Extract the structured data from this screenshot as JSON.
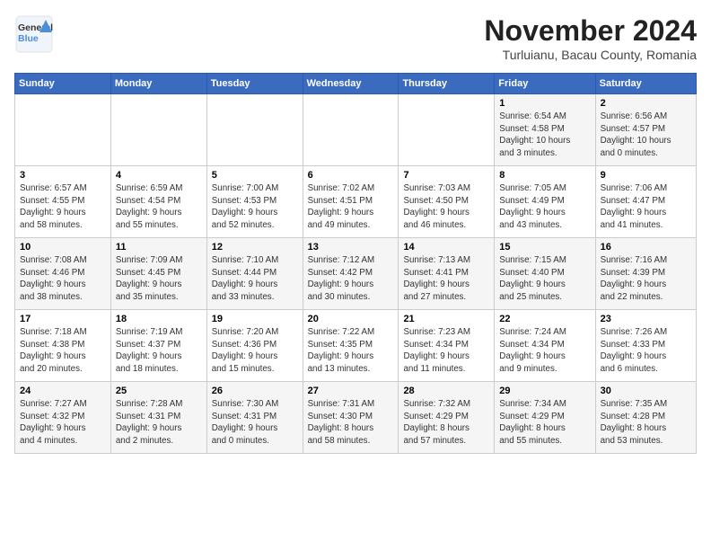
{
  "logo": {
    "line1": "General",
    "line2": "Blue"
  },
  "title": "November 2024",
  "subtitle": "Turluianu, Bacau County, Romania",
  "days_of_week": [
    "Sunday",
    "Monday",
    "Tuesday",
    "Wednesday",
    "Thursday",
    "Friday",
    "Saturday"
  ],
  "weeks": [
    [
      {
        "day": "",
        "info": ""
      },
      {
        "day": "",
        "info": ""
      },
      {
        "day": "",
        "info": ""
      },
      {
        "day": "",
        "info": ""
      },
      {
        "day": "",
        "info": ""
      },
      {
        "day": "1",
        "info": "Sunrise: 6:54 AM\nSunset: 4:58 PM\nDaylight: 10 hours\nand 3 minutes."
      },
      {
        "day": "2",
        "info": "Sunrise: 6:56 AM\nSunset: 4:57 PM\nDaylight: 10 hours\nand 0 minutes."
      }
    ],
    [
      {
        "day": "3",
        "info": "Sunrise: 6:57 AM\nSunset: 4:55 PM\nDaylight: 9 hours\nand 58 minutes."
      },
      {
        "day": "4",
        "info": "Sunrise: 6:59 AM\nSunset: 4:54 PM\nDaylight: 9 hours\nand 55 minutes."
      },
      {
        "day": "5",
        "info": "Sunrise: 7:00 AM\nSunset: 4:53 PM\nDaylight: 9 hours\nand 52 minutes."
      },
      {
        "day": "6",
        "info": "Sunrise: 7:02 AM\nSunset: 4:51 PM\nDaylight: 9 hours\nand 49 minutes."
      },
      {
        "day": "7",
        "info": "Sunrise: 7:03 AM\nSunset: 4:50 PM\nDaylight: 9 hours\nand 46 minutes."
      },
      {
        "day": "8",
        "info": "Sunrise: 7:05 AM\nSunset: 4:49 PM\nDaylight: 9 hours\nand 43 minutes."
      },
      {
        "day": "9",
        "info": "Sunrise: 7:06 AM\nSunset: 4:47 PM\nDaylight: 9 hours\nand 41 minutes."
      }
    ],
    [
      {
        "day": "10",
        "info": "Sunrise: 7:08 AM\nSunset: 4:46 PM\nDaylight: 9 hours\nand 38 minutes."
      },
      {
        "day": "11",
        "info": "Sunrise: 7:09 AM\nSunset: 4:45 PM\nDaylight: 9 hours\nand 35 minutes."
      },
      {
        "day": "12",
        "info": "Sunrise: 7:10 AM\nSunset: 4:44 PM\nDaylight: 9 hours\nand 33 minutes."
      },
      {
        "day": "13",
        "info": "Sunrise: 7:12 AM\nSunset: 4:42 PM\nDaylight: 9 hours\nand 30 minutes."
      },
      {
        "day": "14",
        "info": "Sunrise: 7:13 AM\nSunset: 4:41 PM\nDaylight: 9 hours\nand 27 minutes."
      },
      {
        "day": "15",
        "info": "Sunrise: 7:15 AM\nSunset: 4:40 PM\nDaylight: 9 hours\nand 25 minutes."
      },
      {
        "day": "16",
        "info": "Sunrise: 7:16 AM\nSunset: 4:39 PM\nDaylight: 9 hours\nand 22 minutes."
      }
    ],
    [
      {
        "day": "17",
        "info": "Sunrise: 7:18 AM\nSunset: 4:38 PM\nDaylight: 9 hours\nand 20 minutes."
      },
      {
        "day": "18",
        "info": "Sunrise: 7:19 AM\nSunset: 4:37 PM\nDaylight: 9 hours\nand 18 minutes."
      },
      {
        "day": "19",
        "info": "Sunrise: 7:20 AM\nSunset: 4:36 PM\nDaylight: 9 hours\nand 15 minutes."
      },
      {
        "day": "20",
        "info": "Sunrise: 7:22 AM\nSunset: 4:35 PM\nDaylight: 9 hours\nand 13 minutes."
      },
      {
        "day": "21",
        "info": "Sunrise: 7:23 AM\nSunset: 4:34 PM\nDaylight: 9 hours\nand 11 minutes."
      },
      {
        "day": "22",
        "info": "Sunrise: 7:24 AM\nSunset: 4:34 PM\nDaylight: 9 hours\nand 9 minutes."
      },
      {
        "day": "23",
        "info": "Sunrise: 7:26 AM\nSunset: 4:33 PM\nDaylight: 9 hours\nand 6 minutes."
      }
    ],
    [
      {
        "day": "24",
        "info": "Sunrise: 7:27 AM\nSunset: 4:32 PM\nDaylight: 9 hours\nand 4 minutes."
      },
      {
        "day": "25",
        "info": "Sunrise: 7:28 AM\nSunset: 4:31 PM\nDaylight: 9 hours\nand 2 minutes."
      },
      {
        "day": "26",
        "info": "Sunrise: 7:30 AM\nSunset: 4:31 PM\nDaylight: 9 hours\nand 0 minutes."
      },
      {
        "day": "27",
        "info": "Sunrise: 7:31 AM\nSunset: 4:30 PM\nDaylight: 8 hours\nand 58 minutes."
      },
      {
        "day": "28",
        "info": "Sunrise: 7:32 AM\nSunset: 4:29 PM\nDaylight: 8 hours\nand 57 minutes."
      },
      {
        "day": "29",
        "info": "Sunrise: 7:34 AM\nSunset: 4:29 PM\nDaylight: 8 hours\nand 55 minutes."
      },
      {
        "day": "30",
        "info": "Sunrise: 7:35 AM\nSunset: 4:28 PM\nDaylight: 8 hours\nand 53 minutes."
      }
    ]
  ]
}
